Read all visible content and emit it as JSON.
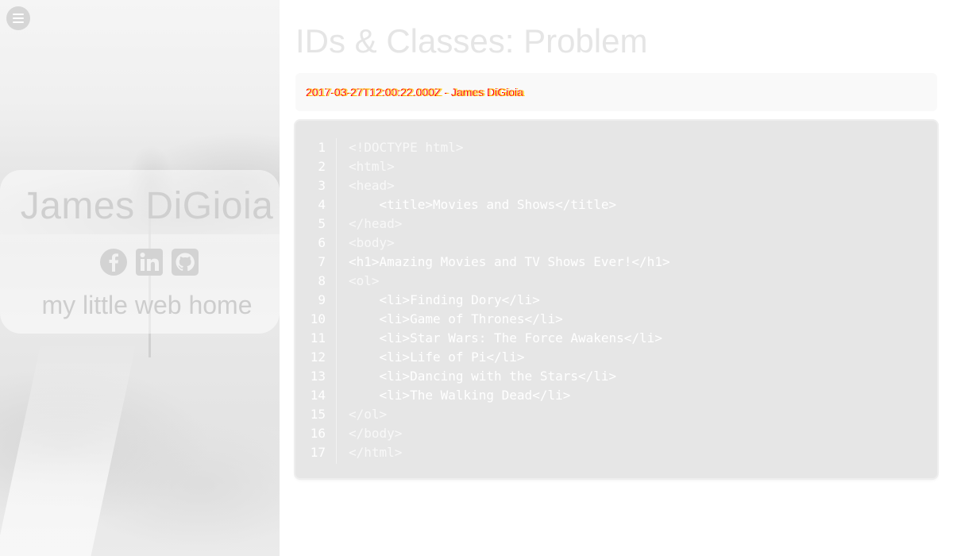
{
  "sidebar": {
    "menu_icon": "hamburger-menu-icon",
    "name": "James DiGioia",
    "tagline": "my little web home",
    "social": [
      {
        "icon": "facebook-icon"
      },
      {
        "icon": "linkedin-icon"
      },
      {
        "icon": "github-icon"
      }
    ]
  },
  "post": {
    "title": "IDs & Classes: Problem",
    "meta_primary": "2017-03-27T12:00:22.000Z - James DiGioia",
    "meta_overlap": "2017-03-27T12:00:22.000Z - James DiGioia",
    "code": {
      "line_numbers": [
        "1",
        "2",
        "3",
        "4",
        "5",
        "6",
        "7",
        "8",
        "9",
        "10",
        "11",
        "12",
        "13",
        "14",
        "15",
        "16",
        "17"
      ],
      "lines": [
        "<!DOCTYPE html>",
        "<html>",
        "<head>",
        "    <title>Movies and Shows</title>",
        "</head>",
        "<body>",
        "<h1>Amazing Movies and TV Shows Ever!</h1>",
        "<ol>",
        "    <li>Finding Dory</li>",
        "    <li>Game of Thrones</li>",
        "    <li>Star Wars: The Force Awakens</li>",
        "    <li>Life of Pi</li>",
        "    <li>Dancing with the Stars</li>",
        "    <li>The Walking Dead</li>",
        "</ol>",
        "</body>",
        "</html>"
      ]
    }
  },
  "colors": {
    "meta_red": "#ff0000",
    "meta_yellow": "#ffcc00",
    "code_bg": "#e6e6e6",
    "meta_bg": "#f9f9f9"
  }
}
